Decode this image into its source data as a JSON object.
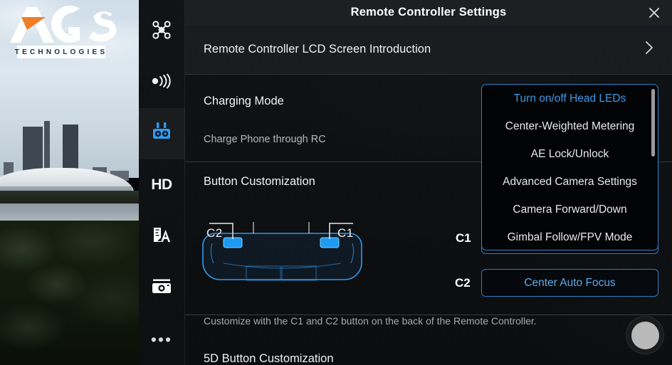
{
  "logo": {
    "brand": "AGS",
    "tagline": "TECHNOLOGIES",
    "accent": "#f07d28"
  },
  "sidebar": {
    "items": [
      {
        "name": "aircraft",
        "icon": "drone-icon",
        "label": "",
        "active": false
      },
      {
        "name": "signal",
        "icon": "signal-waves-icon",
        "label": "",
        "active": false
      },
      {
        "name": "remote-controller",
        "icon": "remote-controller-icon",
        "label": "",
        "active": true
      },
      {
        "name": "video-quality",
        "icon": "hd-icon",
        "label": "HD",
        "active": false
      },
      {
        "name": "focus-assist",
        "icon": "fa-icon",
        "label": "FA",
        "active": false
      },
      {
        "name": "camera",
        "icon": "camera-icon",
        "label": "",
        "active": false
      },
      {
        "name": "more",
        "icon": "ellipsis-icon",
        "label": "•••",
        "active": false
      }
    ]
  },
  "panel": {
    "title": "Remote Controller Settings",
    "close_label": "✕",
    "lcd_intro": {
      "label": "Remote Controller LCD Screen Introduction",
      "chevron": "›"
    },
    "charging": {
      "title": "Charging Mode",
      "subtitle": "Charge Phone through RC"
    },
    "button_customization": {
      "title": "Button Customization",
      "diagram_left_label": "C2",
      "diagram_right_label": "C1",
      "note": "Customize with the C1 and C2 button on the back of the Remote Controller.",
      "c1_key": "C1",
      "c2_key": "C2",
      "c1_value": "Gimbal Follow/FPV Mode",
      "c2_value": "Center Auto Focus"
    },
    "five_d": {
      "title": "5D Button Customization"
    }
  },
  "dropdown": {
    "open": true,
    "selected": "Turn on/off Head LEDs",
    "items": [
      "Turn on/off Head LEDs",
      "Center-Weighted Metering",
      "AE Lock/Unlock",
      "Advanced Camera Settings",
      "Camera Forward/Down",
      "Gimbal Follow/FPV Mode"
    ]
  },
  "camera_controls": {
    "shutter_label": ""
  },
  "colors": {
    "accent_blue": "#3d9ae8",
    "border_blue": "#2f84cc",
    "panel_bg": "#0e0f11",
    "text_primary": "#f0f0f0",
    "text_secondary": "#a9a9a9"
  }
}
